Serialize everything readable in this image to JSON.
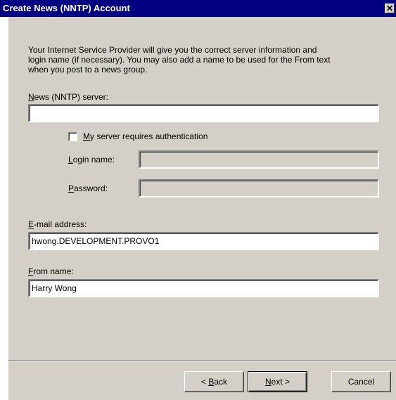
{
  "window": {
    "title": "Create News (NNTP) Account",
    "close_glyph": "✕"
  },
  "intro": {
    "line1": "Your Internet Service Provider will give you the correct server information and",
    "line2": "login name (if necessary).  You may also add a name to be used for the From text",
    "line3": "when you post to a news group."
  },
  "server": {
    "label_key": "N",
    "label_rest": "ews (NNTP) server:",
    "value": ""
  },
  "auth": {
    "label_key": "M",
    "label_rest": "y server requires authentication",
    "checked": false
  },
  "login": {
    "label_key": "L",
    "label_rest": "ogin name:",
    "value": ""
  },
  "password": {
    "label_key": "P",
    "label_rest": "assword:",
    "value": ""
  },
  "email": {
    "label_key": "E",
    "label_rest": "-mail address:",
    "value": "hwong.DEVELOPMENT.PROVO1"
  },
  "from": {
    "label_key": "F",
    "label_rest": "rom name:",
    "value": "Harry Wong"
  },
  "buttons": {
    "back_prefix": "< ",
    "back_key": "B",
    "back_rest": "ack",
    "next_key": "N",
    "next_rest": "ext >",
    "cancel": "Cancel"
  }
}
